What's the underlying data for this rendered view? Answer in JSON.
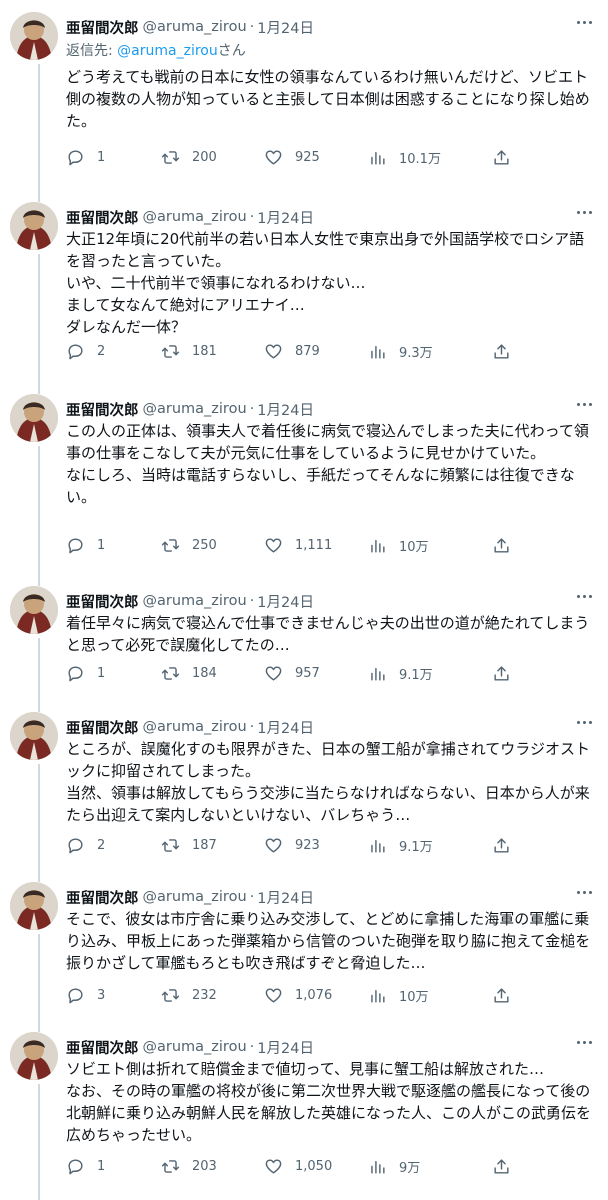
{
  "author": {
    "name": "亜留間次郎",
    "handle": "@aruma_zirou",
    "date": "1月24日"
  },
  "reply_prefix": "返信先: ",
  "reply_handle": "@aruma_zirou",
  "reply_suffix": "さん",
  "tweets": [
    {
      "text": "どう考えても戦前の日本に女性の領事なんているわけ無いんだけど、ソビエト側の複数の人物が知っていると主張して日本側は困惑することになり探し始めた。",
      "replies": "1",
      "retweets": "200",
      "likes": "925",
      "views": "10.1万"
    },
    {
      "text": "大正12年頃に20代前半の若い日本人女性で東京出身で外国語学校でロシア語を習ったと言っていた。\nいや、二十代前半で領事になれるわけない…\nまして女なんて絶対にアリエナイ…\nダレなんだ一体？",
      "replies": "2",
      "retweets": "181",
      "likes": "879",
      "views": "9.3万"
    },
    {
      "text": "この人の正体は、領事夫人で着任後に病気で寝込んでしまった夫に代わって領事の仕事をこなして夫が元気に仕事をしているように見せかけていた。\nなにしろ、当時は電話すらないし、手紙だってそんなに頻繁には往復できない。",
      "replies": "1",
      "retweets": "250",
      "likes": "1,111",
      "views": "10万"
    },
    {
      "text": "着任早々に病気で寝込んで仕事できませんじゃ夫の出世の道が絶たれてしまうと思って必死で誤魔化してたの…",
      "replies": "1",
      "retweets": "184",
      "likes": "957",
      "views": "9.1万"
    },
    {
      "text": "ところが、誤魔化すのも限界がきた、日本の蟹工船が拿捕されてウラジオストックに抑留されてしまった。\n当然、領事は解放してもらう交渉に当たらなければならない、日本から人が来たら出迎えて案内しないといけない、バレちゃう…",
      "replies": "2",
      "retweets": "187",
      "likes": "923",
      "views": "9.1万"
    },
    {
      "text": "そこで、彼女は市庁舎に乗り込み交渉して、とどめに拿捕した海軍の軍艦に乗り込み、甲板上にあった弾薬箱から信管のついた砲弾を取り脇に抱えて金槌を振りかざして軍艦もろとも吹き飛ばすぞと脅迫した…",
      "replies": "3",
      "retweets": "232",
      "likes": "1,076",
      "views": "10万"
    },
    {
      "text": "ソビエト側は折れて賠償金まで値切って、見事に蟹工船は解放された…\nなお、その時の軍艦の将校が後に第二次世界大戦で駆逐艦の艦長になって後の北朝鮮に乗り込み朝鮮人民を解放した英雄になった人、この人がこの武勇伝を広めちゃったせい。",
      "replies": "1",
      "retweets": "203",
      "likes": "1,050",
      "views": "9万"
    }
  ]
}
